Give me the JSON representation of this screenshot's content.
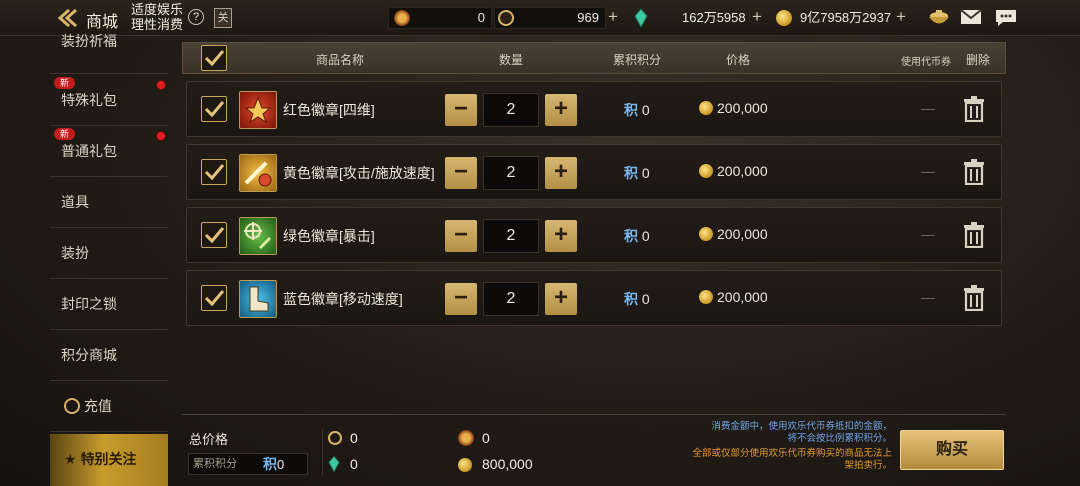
{
  "topbar": {
    "title": "商城",
    "notice_line1": "适度娱乐",
    "notice_line2": "理性消费",
    "help_icon": "question-icon",
    "book_label": "关",
    "currencies": [
      {
        "icon": "red-coin-icon",
        "value": "0"
      },
      {
        "icon": "c-coin-icon",
        "value": "969"
      },
      {
        "icon": "green-gem-icon",
        "value": "162万5958"
      },
      {
        "icon": "gold-coin-icon",
        "value": "9亿7958万2937"
      }
    ],
    "plus": "+"
  },
  "sidebar": {
    "items": [
      {
        "label": "装扮祈福",
        "new": false
      },
      {
        "label": "特殊礼包",
        "new": true
      },
      {
        "label": "普通礼包",
        "new": true
      },
      {
        "label": "道具",
        "new": false
      },
      {
        "label": "装扮",
        "new": false
      },
      {
        "label": "封印之锁",
        "new": false
      },
      {
        "label": "积分商城",
        "new": false
      },
      {
        "label": "充值",
        "new": false
      },
      {
        "label": "特别关注",
        "new": false
      }
    ],
    "new_tag": "新"
  },
  "table": {
    "headers": {
      "name": "商品名称",
      "quantity": "数量",
      "points": "累积积分",
      "price": "价格",
      "voucher": "使用代币券",
      "delete": "删除"
    },
    "rows": [
      {
        "name": "红色徽章[四维]",
        "qty": "2",
        "points": "0",
        "price": "200,000",
        "voucher": "—",
        "icon_color": "#b8241a"
      },
      {
        "name": "黄色徽章[攻击/施放速度]",
        "qty": "2",
        "points": "0",
        "price": "200,000",
        "voucher": "—",
        "icon_color": "#d49a22"
      },
      {
        "name": "绿色徽章[暴击]",
        "qty": "2",
        "points": "0",
        "price": "200,000",
        "voucher": "—",
        "icon_color": "#3e8e2c"
      },
      {
        "name": "蓝色徽章[移动速度]",
        "qty": "2",
        "points": "0",
        "price": "200,000",
        "voucher": "—",
        "icon_color": "#2a8ab8"
      }
    ],
    "points_glyph": "积",
    "minus": "−",
    "plus": "+"
  },
  "footer": {
    "total_label": "总价格",
    "accum_label": "累积积分",
    "accum_value": "0",
    "c_coin_value": "0",
    "gem_value": "0",
    "red_coin_value": "0",
    "gold_value": "800,000",
    "note_line1": "消费金额中，使用欢乐代币券抵扣的金额，",
    "note_line2": "将不会按比例累积积分。",
    "note_line3": "全部或仅部分使用欢乐代币券购买的商品无法上",
    "note_line4": "架拍卖行。",
    "buy_label": "购买"
  },
  "colors": {
    "accent_gold": "#c9a65a",
    "points_blue": "#78b6ef",
    "notice_orange": "#e39b2e",
    "new_red": "#c21d1d"
  }
}
